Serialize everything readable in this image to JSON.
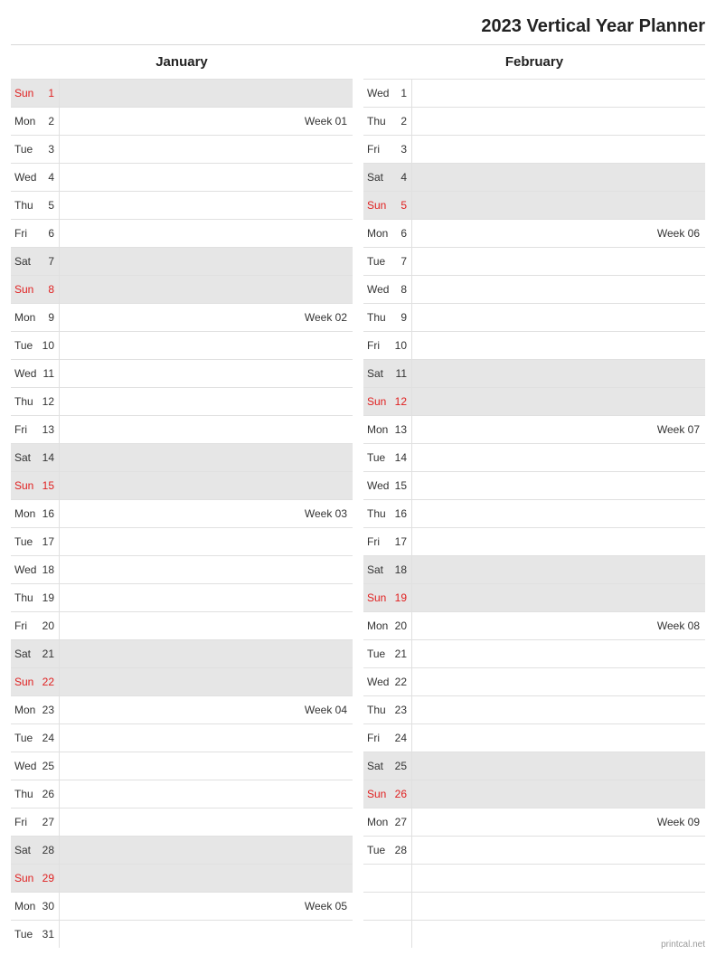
{
  "title": "2023 Vertical Year Planner",
  "footer": "printcal.net",
  "months": [
    {
      "name": "January",
      "days": [
        {
          "dow": "Sun",
          "n": 1,
          "weekend": true,
          "sunday": true,
          "note": ""
        },
        {
          "dow": "Mon",
          "n": 2,
          "weekend": false,
          "sunday": false,
          "note": "Week 01"
        },
        {
          "dow": "Tue",
          "n": 3,
          "weekend": false,
          "sunday": false,
          "note": ""
        },
        {
          "dow": "Wed",
          "n": 4,
          "weekend": false,
          "sunday": false,
          "note": ""
        },
        {
          "dow": "Thu",
          "n": 5,
          "weekend": false,
          "sunday": false,
          "note": ""
        },
        {
          "dow": "Fri",
          "n": 6,
          "weekend": false,
          "sunday": false,
          "note": ""
        },
        {
          "dow": "Sat",
          "n": 7,
          "weekend": true,
          "sunday": false,
          "note": ""
        },
        {
          "dow": "Sun",
          "n": 8,
          "weekend": true,
          "sunday": true,
          "note": ""
        },
        {
          "dow": "Mon",
          "n": 9,
          "weekend": false,
          "sunday": false,
          "note": "Week 02"
        },
        {
          "dow": "Tue",
          "n": 10,
          "weekend": false,
          "sunday": false,
          "note": ""
        },
        {
          "dow": "Wed",
          "n": 11,
          "weekend": false,
          "sunday": false,
          "note": ""
        },
        {
          "dow": "Thu",
          "n": 12,
          "weekend": false,
          "sunday": false,
          "note": ""
        },
        {
          "dow": "Fri",
          "n": 13,
          "weekend": false,
          "sunday": false,
          "note": ""
        },
        {
          "dow": "Sat",
          "n": 14,
          "weekend": true,
          "sunday": false,
          "note": ""
        },
        {
          "dow": "Sun",
          "n": 15,
          "weekend": true,
          "sunday": true,
          "note": ""
        },
        {
          "dow": "Mon",
          "n": 16,
          "weekend": false,
          "sunday": false,
          "note": "Week 03"
        },
        {
          "dow": "Tue",
          "n": 17,
          "weekend": false,
          "sunday": false,
          "note": ""
        },
        {
          "dow": "Wed",
          "n": 18,
          "weekend": false,
          "sunday": false,
          "note": ""
        },
        {
          "dow": "Thu",
          "n": 19,
          "weekend": false,
          "sunday": false,
          "note": ""
        },
        {
          "dow": "Fri",
          "n": 20,
          "weekend": false,
          "sunday": false,
          "note": ""
        },
        {
          "dow": "Sat",
          "n": 21,
          "weekend": true,
          "sunday": false,
          "note": ""
        },
        {
          "dow": "Sun",
          "n": 22,
          "weekend": true,
          "sunday": true,
          "note": ""
        },
        {
          "dow": "Mon",
          "n": 23,
          "weekend": false,
          "sunday": false,
          "note": "Week 04"
        },
        {
          "dow": "Tue",
          "n": 24,
          "weekend": false,
          "sunday": false,
          "note": ""
        },
        {
          "dow": "Wed",
          "n": 25,
          "weekend": false,
          "sunday": false,
          "note": ""
        },
        {
          "dow": "Thu",
          "n": 26,
          "weekend": false,
          "sunday": false,
          "note": ""
        },
        {
          "dow": "Fri",
          "n": 27,
          "weekend": false,
          "sunday": false,
          "note": ""
        },
        {
          "dow": "Sat",
          "n": 28,
          "weekend": true,
          "sunday": false,
          "note": ""
        },
        {
          "dow": "Sun",
          "n": 29,
          "weekend": true,
          "sunday": true,
          "note": ""
        },
        {
          "dow": "Mon",
          "n": 30,
          "weekend": false,
          "sunday": false,
          "note": "Week 05"
        },
        {
          "dow": "Tue",
          "n": 31,
          "weekend": false,
          "sunday": false,
          "note": ""
        }
      ],
      "fillers": 0
    },
    {
      "name": "February",
      "days": [
        {
          "dow": "Wed",
          "n": 1,
          "weekend": false,
          "sunday": false,
          "note": ""
        },
        {
          "dow": "Thu",
          "n": 2,
          "weekend": false,
          "sunday": false,
          "note": ""
        },
        {
          "dow": "Fri",
          "n": 3,
          "weekend": false,
          "sunday": false,
          "note": ""
        },
        {
          "dow": "Sat",
          "n": 4,
          "weekend": true,
          "sunday": false,
          "note": ""
        },
        {
          "dow": "Sun",
          "n": 5,
          "weekend": true,
          "sunday": true,
          "note": ""
        },
        {
          "dow": "Mon",
          "n": 6,
          "weekend": false,
          "sunday": false,
          "note": "Week 06"
        },
        {
          "dow": "Tue",
          "n": 7,
          "weekend": false,
          "sunday": false,
          "note": ""
        },
        {
          "dow": "Wed",
          "n": 8,
          "weekend": false,
          "sunday": false,
          "note": ""
        },
        {
          "dow": "Thu",
          "n": 9,
          "weekend": false,
          "sunday": false,
          "note": ""
        },
        {
          "dow": "Fri",
          "n": 10,
          "weekend": false,
          "sunday": false,
          "note": ""
        },
        {
          "dow": "Sat",
          "n": 11,
          "weekend": true,
          "sunday": false,
          "note": ""
        },
        {
          "dow": "Sun",
          "n": 12,
          "weekend": true,
          "sunday": true,
          "note": ""
        },
        {
          "dow": "Mon",
          "n": 13,
          "weekend": false,
          "sunday": false,
          "note": "Week 07"
        },
        {
          "dow": "Tue",
          "n": 14,
          "weekend": false,
          "sunday": false,
          "note": ""
        },
        {
          "dow": "Wed",
          "n": 15,
          "weekend": false,
          "sunday": false,
          "note": ""
        },
        {
          "dow": "Thu",
          "n": 16,
          "weekend": false,
          "sunday": false,
          "note": ""
        },
        {
          "dow": "Fri",
          "n": 17,
          "weekend": false,
          "sunday": false,
          "note": ""
        },
        {
          "dow": "Sat",
          "n": 18,
          "weekend": true,
          "sunday": false,
          "note": ""
        },
        {
          "dow": "Sun",
          "n": 19,
          "weekend": true,
          "sunday": true,
          "note": ""
        },
        {
          "dow": "Mon",
          "n": 20,
          "weekend": false,
          "sunday": false,
          "note": "Week 08"
        },
        {
          "dow": "Tue",
          "n": 21,
          "weekend": false,
          "sunday": false,
          "note": ""
        },
        {
          "dow": "Wed",
          "n": 22,
          "weekend": false,
          "sunday": false,
          "note": ""
        },
        {
          "dow": "Thu",
          "n": 23,
          "weekend": false,
          "sunday": false,
          "note": ""
        },
        {
          "dow": "Fri",
          "n": 24,
          "weekend": false,
          "sunday": false,
          "note": ""
        },
        {
          "dow": "Sat",
          "n": 25,
          "weekend": true,
          "sunday": false,
          "note": ""
        },
        {
          "dow": "Sun",
          "n": 26,
          "weekend": true,
          "sunday": true,
          "note": ""
        },
        {
          "dow": "Mon",
          "n": 27,
          "weekend": false,
          "sunday": false,
          "note": "Week 09"
        },
        {
          "dow": "Tue",
          "n": 28,
          "weekend": false,
          "sunday": false,
          "note": ""
        }
      ],
      "fillers": 3
    }
  ]
}
